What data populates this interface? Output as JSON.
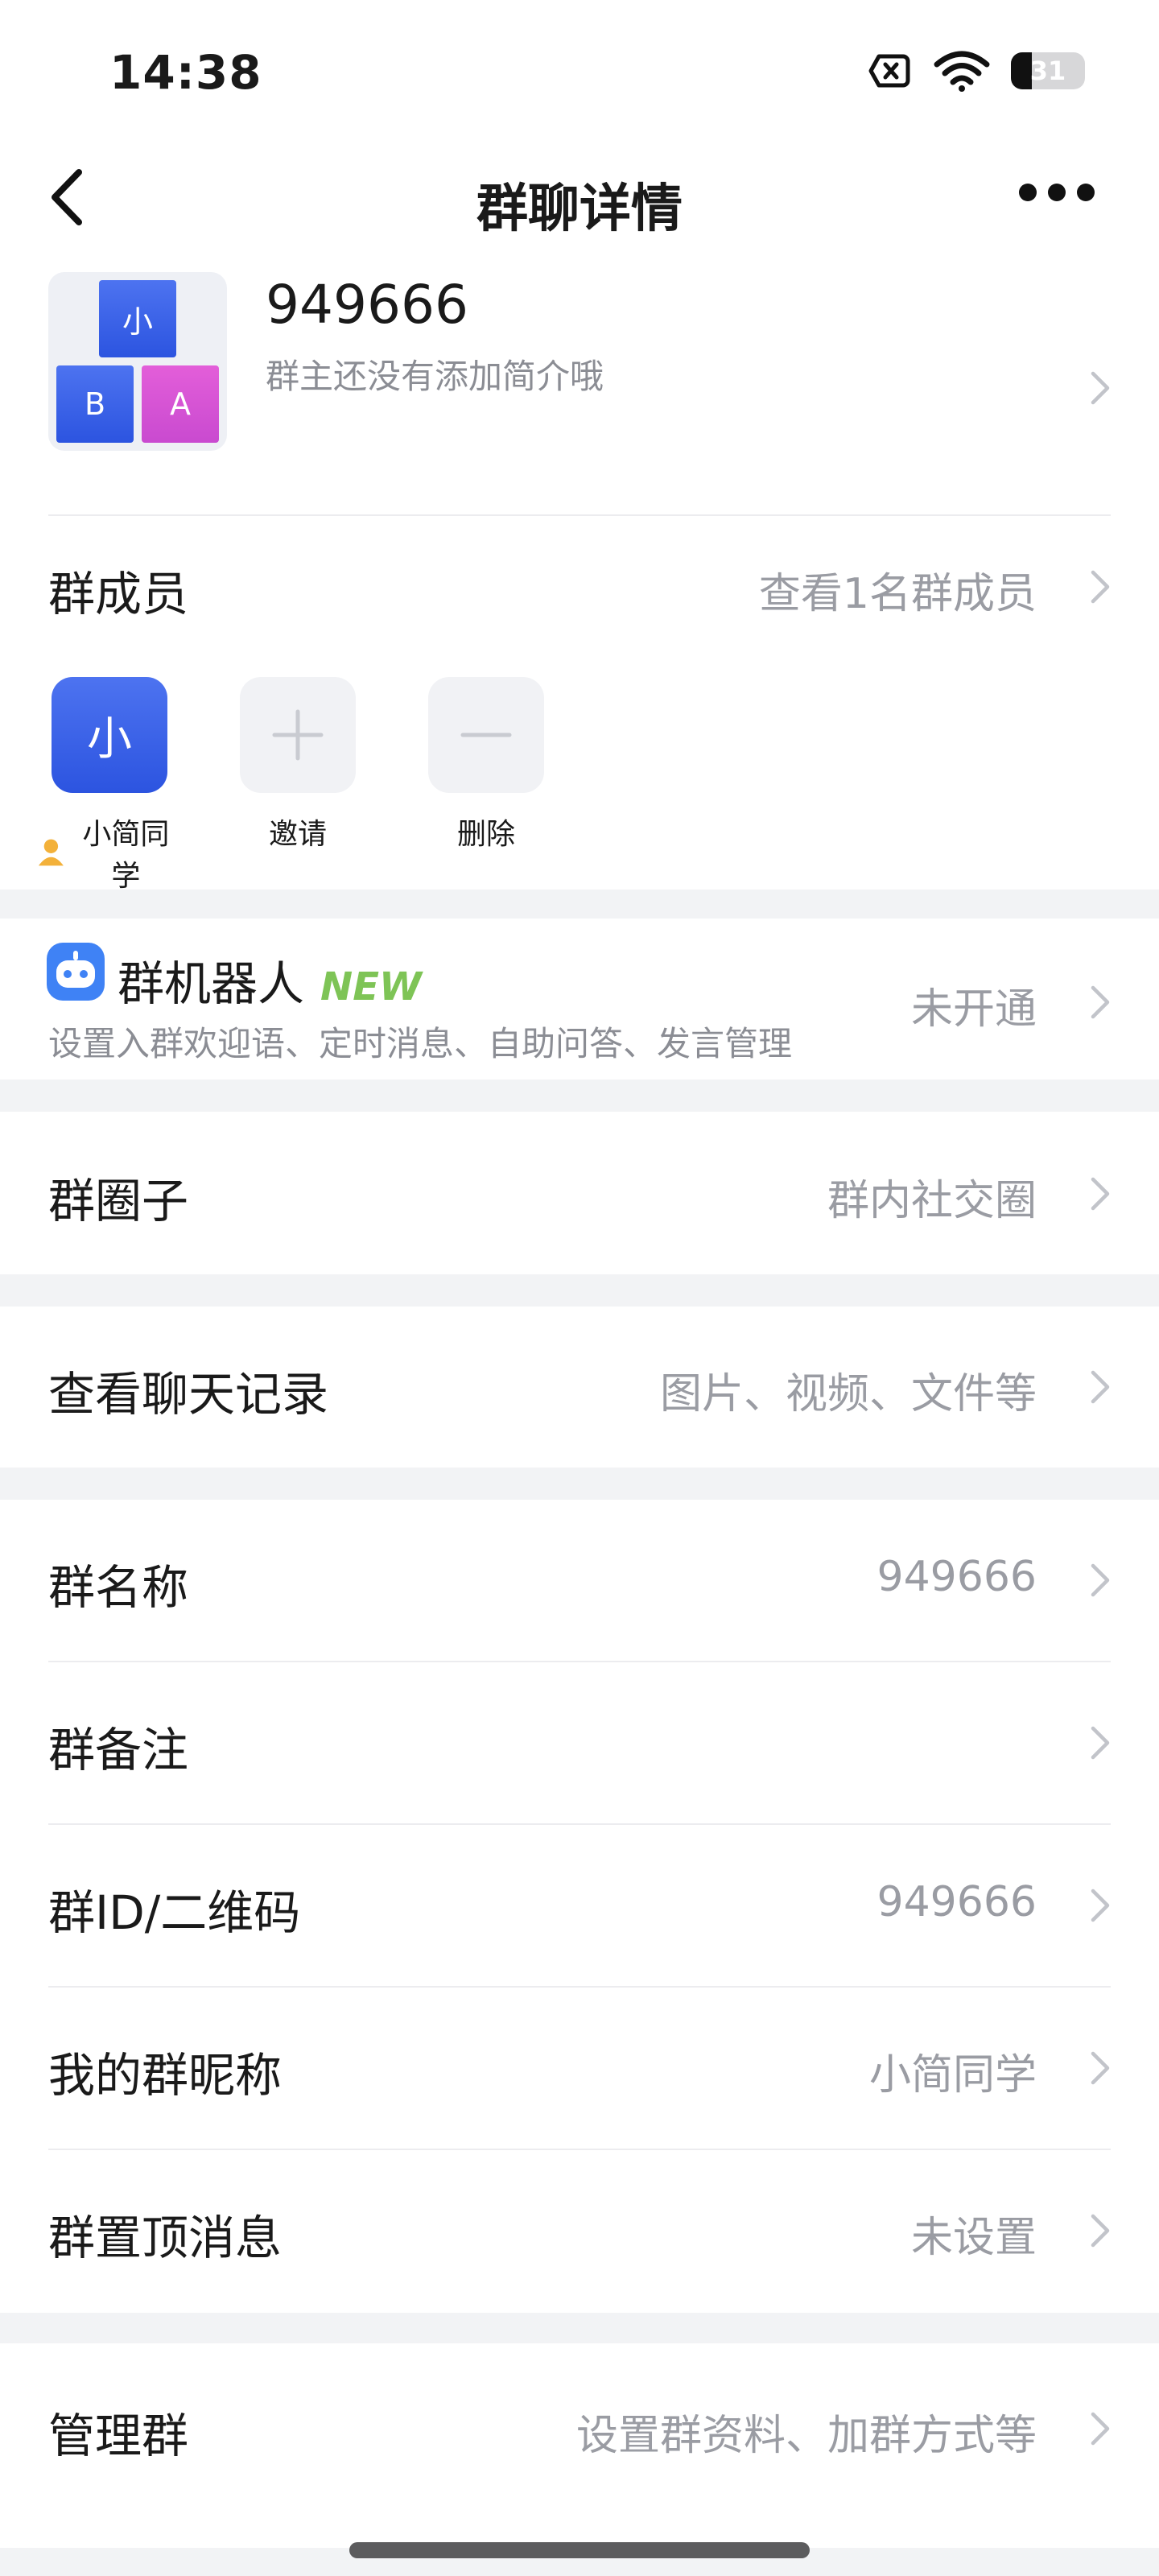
{
  "status_bar": {
    "time": "14:38",
    "battery": "31"
  },
  "nav": {
    "title": "群聊详情"
  },
  "group": {
    "name": "949666",
    "description": "群主还没有添加简介哦",
    "avatar_tiles": [
      "小",
      "B",
      "A"
    ]
  },
  "members": {
    "title": "群成员",
    "value": "查看1名群成员",
    "items": [
      {
        "avatar_text": "小",
        "label": "小简同学"
      },
      {
        "avatar_text": "+",
        "label": "邀请"
      },
      {
        "avatar_text": "−",
        "label": "删除"
      }
    ]
  },
  "robot": {
    "title": "群机器人",
    "tag": "NEW",
    "subtitle": "设置入群欢迎语、定时消息、自助问答、发言管理",
    "value": "未开通"
  },
  "circle": {
    "title": "群圈子",
    "value": "群内社交圈"
  },
  "history": {
    "title": "查看聊天记录",
    "value": "图片、视频、文件等"
  },
  "settings": [
    {
      "title": "群名称",
      "value": "949666"
    },
    {
      "title": "群备注",
      "value": ""
    },
    {
      "title": "群ID/二维码",
      "value": "949666"
    },
    {
      "title": "我的群昵称",
      "value": "小简同学"
    },
    {
      "title": "群置顶消息",
      "value": "未设置"
    }
  ],
  "manage": {
    "title": "管理群",
    "value": "设置群资料、加群方式等"
  },
  "colors": {
    "accent": "#3a63e6",
    "new_tag": "#7ec456",
    "muted": "#9a9ca3"
  }
}
